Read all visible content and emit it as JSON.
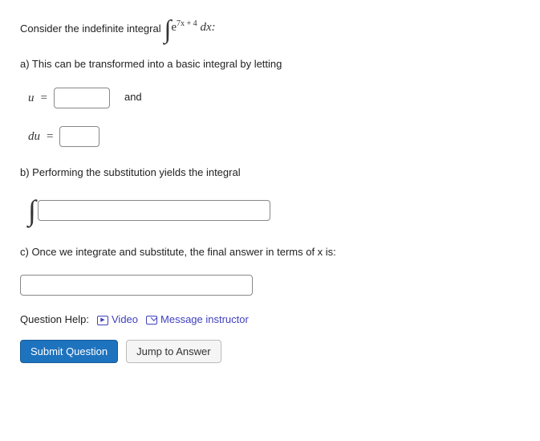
{
  "prompt": {
    "prefix": "Consider the indefinite integral",
    "integral_base": "e",
    "integral_exponent": "7x + 4",
    "integral_dx": "dx:",
    "suffix": ""
  },
  "part_a": {
    "text": "a) This can be transformed into a basic integral by letting",
    "u_var": "u",
    "equals": "=",
    "and": "and",
    "du_var": "du"
  },
  "part_b": {
    "text": "b) Performing the substitution yields the integral"
  },
  "part_c": {
    "text": "c) Once we integrate and substitute, the final answer in terms of x is:"
  },
  "help": {
    "label": "Question Help:",
    "video": "Video",
    "message": "Message instructor"
  },
  "buttons": {
    "submit": "Submit Question",
    "jump": "Jump to Answer"
  }
}
